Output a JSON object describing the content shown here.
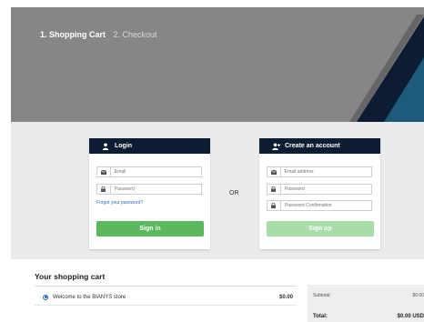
{
  "steps": {
    "active": "1. Shopping Cart",
    "next": "2. Checkout"
  },
  "login": {
    "title": "Login",
    "email_placeholder": "Email",
    "password_placeholder": "Password",
    "forgot_link": "Forgot your password?",
    "signin_label": "Sign in"
  },
  "separator": "OR",
  "register": {
    "title": "Create an account",
    "email_placeholder": "Email address",
    "password_placeholder": "Password",
    "confirm_placeholder": "Password Confirmation",
    "signup_label": "Sign up"
  },
  "cart": {
    "title": "Your shopping cart",
    "item_label": "Welcome to the BIANYS store",
    "item_price": "$0.00"
  },
  "summary": {
    "subtotal_label": "Subtotal:",
    "subtotal_value": "$0.00",
    "total_label": "Total:",
    "total_value": "$0.00 USD"
  },
  "colors": {
    "header_bg": "#0b1c33",
    "signin": "#5cb85c",
    "signup": "#a8dca8",
    "link": "#2f6ebd"
  }
}
